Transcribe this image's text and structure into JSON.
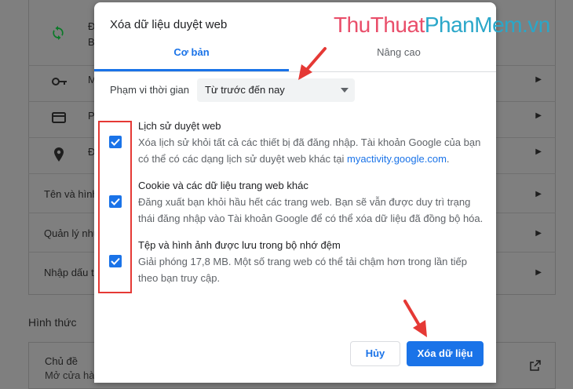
{
  "background": {
    "rows": [
      {
        "label": "Đ",
        "sublabel": "B",
        "icon": "sync-icon"
      },
      {
        "label": "M",
        "icon": "key-icon"
      },
      {
        "label": "P",
        "icon": "credit-card-icon"
      },
      {
        "label": "Đ",
        "icon": "location-pin-icon"
      },
      {
        "label": "Tên và hình"
      },
      {
        "label": "Quản lý nhũ"
      },
      {
        "label": "Nhập dấu t"
      }
    ],
    "section_title": "Hình thức",
    "theme_label": "Chủ đề",
    "theme_sub": "Mở cửa hàn"
  },
  "watermark": {
    "part1": "ThuThuat",
    "part2": "PhanMem",
    "part3": ".vn"
  },
  "dialog": {
    "title": "Xóa dữ liệu duyệt web",
    "tabs": [
      {
        "label": "Cơ bản",
        "active": true
      },
      {
        "label": "Nâng cao",
        "active": false
      }
    ],
    "time_range": {
      "label": "Phạm vi thời gian",
      "value": "Từ trước đến nay"
    },
    "options": [
      {
        "checked": true,
        "title": "Lịch sử duyệt web",
        "desc": "Xóa lịch sử khỏi tất cả các thiết bị đã đăng nhập. Tài khoản Google của bạn có thể có các dạng lịch sử duyệt web khác tại",
        "link": "myactivity.google.com",
        "desc_end": "."
      },
      {
        "checked": true,
        "title": "Cookie và các dữ liệu trang web khác",
        "desc": "Đăng xuất bạn khỏi hầu hết các trang web. Bạn sẽ vẫn được duy trì trạng thái đăng nhập vào Tài khoản Google để có thể xóa dữ liệu đã đồng bộ hóa."
      },
      {
        "checked": true,
        "title": "Tệp và hình ảnh được lưu trong bộ nhớ đệm",
        "desc": "Giải phóng 17,8 MB. Một số trang web có thể tải chậm hơn trong lần tiếp theo bạn truy cập."
      }
    ],
    "cancel_label": "Hủy",
    "clear_label": "Xóa dữ liệu"
  },
  "colors": {
    "accent": "#1a73e8",
    "annotation": "#e53935"
  }
}
